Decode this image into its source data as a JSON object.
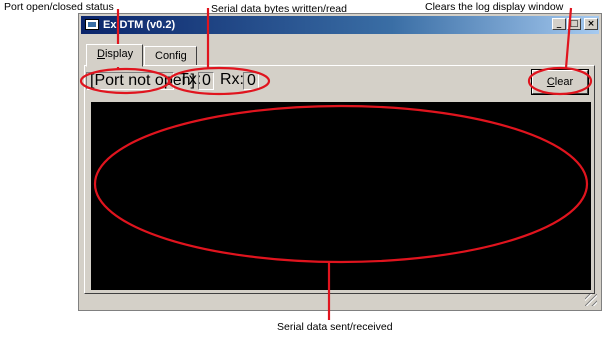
{
  "callouts": {
    "port_status": "Port open/closed status",
    "serial_bytes": "Serial data bytes written/read",
    "clear_log": "Clears the log display window",
    "serial_data": "Serial data sent/received"
  },
  "window": {
    "title": "ExiDTM (v0.2)",
    "buttons": {
      "minimize": "_",
      "maximize": "□",
      "close": "×"
    }
  },
  "tabs": [
    {
      "label_first": "D",
      "label_rest": "isplay"
    },
    {
      "label_first": "Config",
      "label_rest": ""
    }
  ],
  "status": {
    "port": "[Port not open]",
    "tx_label": "Tx:",
    "tx_value": "0",
    "rx_label": "Rx:",
    "rx_value": "0"
  },
  "clear_button": {
    "first": "C",
    "rest": "lear"
  },
  "colors": {
    "annotation": "#e0141e",
    "log_background": "#000000",
    "title_start": "#0a246a"
  }
}
